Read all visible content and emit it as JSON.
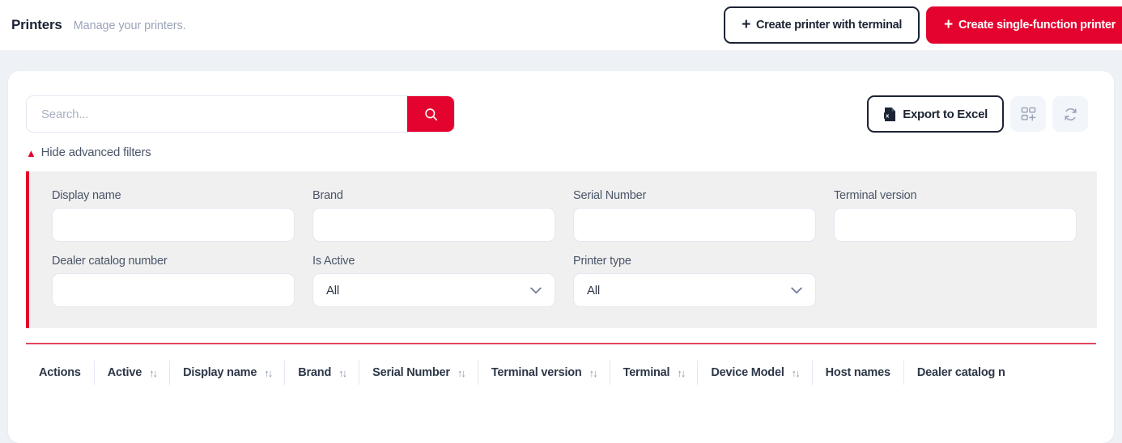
{
  "header": {
    "title": "Printers",
    "subtitle": "Manage your printers.",
    "create_with_terminal_label": "Create printer with terminal",
    "create_single_function_label": "Create single-function printer",
    "plus_glyph": "+"
  },
  "toolbar": {
    "search_placeholder": "Search...",
    "search_value": "",
    "search_icon": "search-icon",
    "export_label": "Export to Excel",
    "export_icon": "excel-file-icon",
    "columns_icon": "grid-plus-icon",
    "refresh_icon": "refresh-icon"
  },
  "filters": {
    "toggle_label": "Hide advanced filters",
    "toggle_caret": "▲",
    "fields": [
      {
        "label": "Display name",
        "type": "text",
        "value": ""
      },
      {
        "label": "Brand",
        "type": "text",
        "value": ""
      },
      {
        "label": "Serial Number",
        "type": "text",
        "value": ""
      },
      {
        "label": "Terminal version",
        "type": "text",
        "value": ""
      },
      {
        "label": "Dealer catalog number",
        "type": "text",
        "value": ""
      },
      {
        "label": "Is Active",
        "type": "select",
        "value": "All"
      },
      {
        "label": "Printer type",
        "type": "select",
        "value": "All"
      }
    ],
    "chevron": "⌄"
  },
  "table": {
    "sort_glyph": "↑↓",
    "columns": [
      {
        "label": "Actions",
        "sortable": false
      },
      {
        "label": "Active",
        "sortable": true
      },
      {
        "label": "Display name",
        "sortable": true
      },
      {
        "label": "Brand",
        "sortable": true
      },
      {
        "label": "Serial Number",
        "sortable": true
      },
      {
        "label": "Terminal version",
        "sortable": true
      },
      {
        "label": "Terminal",
        "sortable": true
      },
      {
        "label": "Device Model",
        "sortable": true
      },
      {
        "label": "Host names",
        "sortable": false
      },
      {
        "label": "Dealer catalog n",
        "sortable": false
      }
    ]
  },
  "colors": {
    "brand_red": "#e4032e",
    "divider_red": "#e4455f",
    "page_bg": "#eef1f6",
    "panel_bg": "#f0f0f0",
    "dark": "#1c2434"
  }
}
